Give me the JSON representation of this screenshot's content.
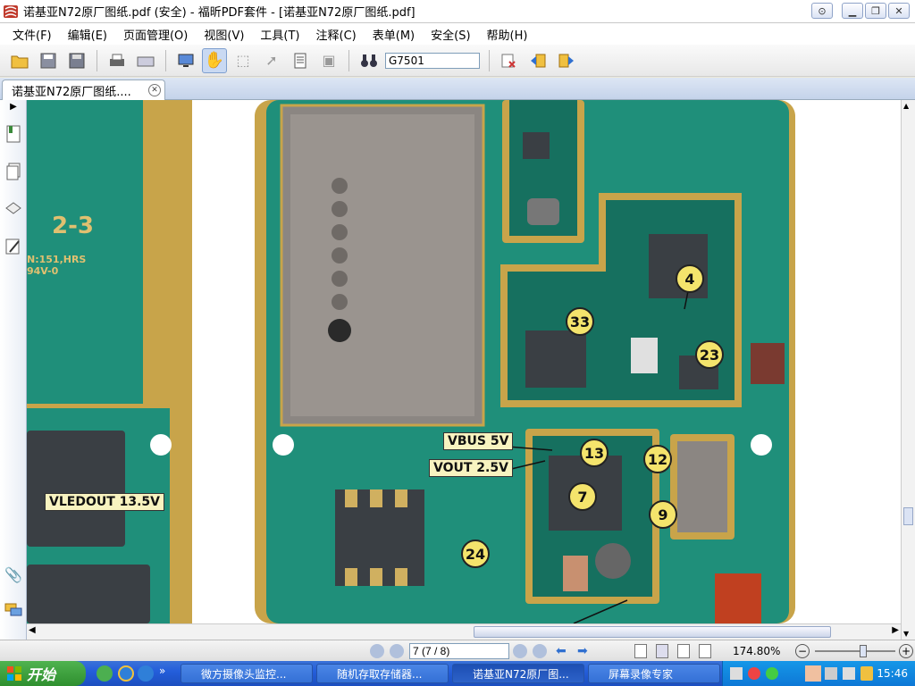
{
  "window": {
    "title": "诺基亚N72原厂图纸.pdf (安全) - 福昕PDF套件 - [诺基亚N72原厂图纸.pdf]"
  },
  "menu": [
    "文件(F)",
    "编辑(E)",
    "页面管理(O)",
    "视图(V)",
    "工具(T)",
    "注释(C)",
    "表单(M)",
    "安全(S)",
    "帮助(H)"
  ],
  "toolbar": {
    "search_value": "G7501"
  },
  "tab": {
    "label": "诺基亚N72原厂图纸...."
  },
  "document": {
    "labels": {
      "vbus": "VBUS 5V",
      "vout": "VOUT 2.5V",
      "vledout": "VLEDOUT 13.5V",
      "board_code": "2-3",
      "board_sub": "N:151,HRS 94V-0"
    },
    "callouts": [
      "4",
      "33",
      "23",
      "13",
      "12",
      "7",
      "9",
      "24"
    ]
  },
  "status": {
    "page_value": "7 (7 / 8)",
    "zoom": "174.80%"
  },
  "taskbar": {
    "start": "开始",
    "tasks": [
      "微方摄像头监控...",
      "随机存取存储器...",
      "诺基亚N72原厂图...",
      "屏幕录像专家"
    ],
    "clock": "15:46"
  },
  "colors": {
    "pcb": "#1f8f7a",
    "gold": "#c8a44a",
    "accent": "#245edb"
  }
}
